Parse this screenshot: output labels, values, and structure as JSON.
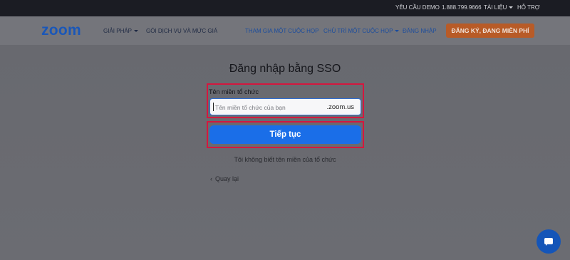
{
  "topbar": {
    "demo": "YÊU CẦU DEMO",
    "phone": "1.888.799.9666",
    "resources": "TÀI LIỆU",
    "support": "HỖ TRỢ"
  },
  "nav": {
    "logo": "zoom",
    "solutions": "GIẢI PHÁP",
    "plans": "GÓI DỊCH VỤ VÀ MỨC GIÁ",
    "join": "THAM GIA MỘT CUỘC HỌP",
    "host": "CHỦ TRÌ MỘT CUỘC HỌP",
    "signin": "ĐĂNG NHẬP",
    "signup": "ĐĂNG KÝ, ĐANG MIỄN PHÍ"
  },
  "form": {
    "title": "Đăng nhập bằng SSO",
    "field_label": "Tên miền tổ chức",
    "placeholder": "Tên miền tổ chức của bạn",
    "suffix": ".zoom.us",
    "continue": "Tiếp tục",
    "no_domain": "Tôi không biết tên miền của tổ chức",
    "back": "Quay lại"
  },
  "colors": {
    "highlight": "#d4173e",
    "primary_button": "#1a6ee8",
    "signup_button": "#b85b27",
    "logo": "#1a57b8"
  },
  "icons": {
    "dropdown": "caret-down-icon",
    "back": "chevron-left-icon",
    "chat": "chat-bubble-icon"
  }
}
